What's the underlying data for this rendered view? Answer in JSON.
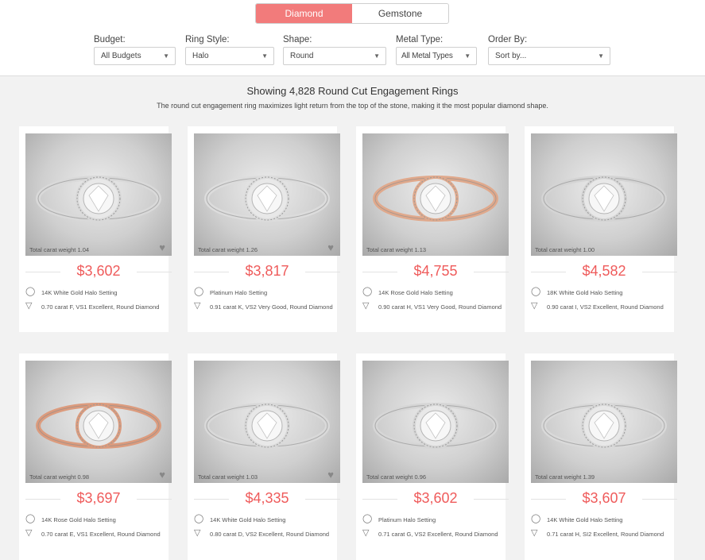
{
  "toggle": {
    "diamond": "Diamond",
    "gemstone": "Gemstone"
  },
  "filters": {
    "budget": {
      "label": "Budget:",
      "value": "All Budgets"
    },
    "ring_style": {
      "label": "Ring Style:",
      "value": "Halo"
    },
    "shape": {
      "label": "Shape:",
      "value": "Round"
    },
    "metal": {
      "label": "Metal Type:",
      "value": "All Metal Types"
    },
    "order": {
      "label": "Order By:",
      "value": "Sort by..."
    }
  },
  "heading": "Showing 4,828 Round Cut Engagement Rings",
  "subheading": "The round cut engagement ring maximizes light return from the top of the stone, making it the most popular diamond shape.",
  "products": [
    {
      "carat": "Total carat weight 1.04",
      "price": "$3,602",
      "setting": "14K White Gold Halo Setting",
      "diamond": "0.70 carat F, VS1 Excellent, Round Diamond",
      "metal_color": "#d9d9d9"
    },
    {
      "carat": "Total carat weight 1.26",
      "price": "$3,817",
      "setting": "Platinum Halo Setting",
      "diamond": "0.91 carat K, VS2 Very Good, Round Diamond",
      "metal_color": "#dcdcdc"
    },
    {
      "carat": "Total carat weight 1.13",
      "price": "$4,755",
      "setting": "14K Rose Gold Halo Setting",
      "diamond": "0.90 carat H, VS1 Very Good, Round Diamond",
      "metal_color": "#e0a98c"
    },
    {
      "carat": "Total carat weight 1.00",
      "price": "$4,582",
      "setting": "18K White Gold Halo Setting",
      "diamond": "0.90 carat I, VS2 Excellent, Round Diamond",
      "metal_color": "#d4d4d4"
    },
    {
      "carat": "Total carat weight 0.98",
      "price": "$3,697",
      "setting": "14K Rose Gold Halo Setting",
      "diamond": "0.70 carat E, VS1 Excellent, Round Diamond",
      "metal_color": "#dc9b7d"
    },
    {
      "carat": "Total carat weight 1.03",
      "price": "$4,335",
      "setting": "14K White Gold Halo Setting",
      "diamond": "0.80 carat D, VS2 Excellent, Round Diamond",
      "metal_color": "#d9d9d9"
    },
    {
      "carat": "Total carat weight 0.96",
      "price": "$3,602",
      "setting": "Platinum Halo Setting",
      "diamond": "0.71 carat G, VS2 Excellent, Round Diamond",
      "metal_color": "#d6d6d6"
    },
    {
      "carat": "Total carat weight 1.39",
      "price": "$3,607",
      "setting": "14K White Gold Halo Setting",
      "diamond": "0.71 carat H, SI2 Excellent, Round Diamond",
      "metal_color": "#d9d9d9"
    }
  ],
  "colors": {
    "accent": "#f27b7b",
    "price": "#ef5b5b"
  }
}
